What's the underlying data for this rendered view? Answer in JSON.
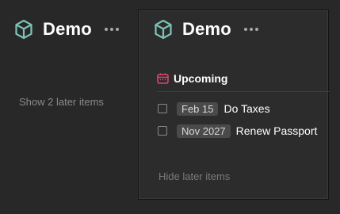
{
  "background_color": "#282828",
  "accent_color": "#7ec4b6",
  "left_project": {
    "icon": "cube-icon",
    "title": "Demo",
    "menu_icon": "more-horizontal-icon",
    "show_later_label": "Show 2 later items"
  },
  "right_project": {
    "icon": "cube-icon",
    "title": "Demo",
    "menu_icon": "more-horizontal-icon",
    "section": {
      "icon": "calendar-icon",
      "icon_color": "#e0436c",
      "title": "Upcoming"
    },
    "tasks": [
      {
        "date": "Feb 15",
        "title": "Do Taxes",
        "completed": false
      },
      {
        "date": "Nov 2027",
        "title": "Renew Passport",
        "completed": false
      }
    ],
    "hide_later_label": "Hide later items"
  }
}
